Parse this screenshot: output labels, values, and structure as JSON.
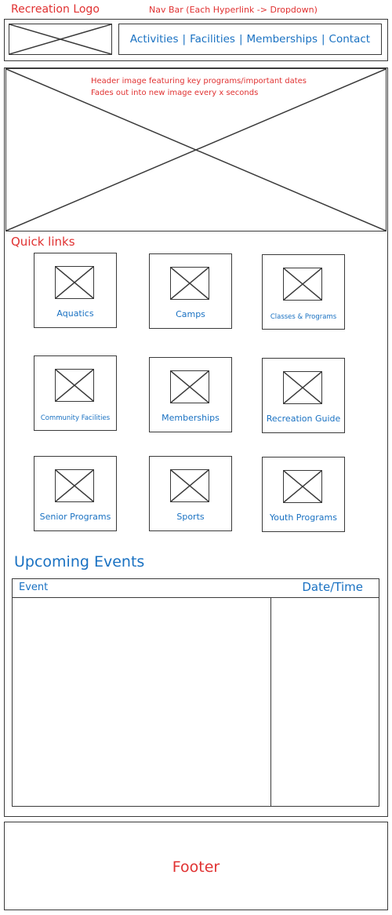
{
  "annotations": {
    "logo_label": "Recreation Logo",
    "nav_label": "Nav Bar (Each Hyperlink -> Dropdown)",
    "header_note_line1": "Header image featuring key programs/important dates",
    "header_note_line2": "Fades out into new image every x seconds"
  },
  "nav": {
    "links": [
      "Activities",
      "Facilities",
      "Memberships",
      "Contact"
    ],
    "separator": "|"
  },
  "quick_links": {
    "title": "Quick links",
    "items": [
      {
        "label": "Aquatics",
        "icon": "image-placeholder-icon"
      },
      {
        "label": "Camps",
        "icon": "image-placeholder-icon"
      },
      {
        "label": "Classes & Programs",
        "icon": "image-placeholder-icon"
      },
      {
        "label": "Community Facilities",
        "icon": "image-placeholder-icon"
      },
      {
        "label": "Memberships",
        "icon": "image-placeholder-icon"
      },
      {
        "label": "Recreation Guide",
        "icon": "image-placeholder-icon"
      },
      {
        "label": "Senior Programs",
        "icon": "image-placeholder-icon"
      },
      {
        "label": "Sports",
        "icon": "image-placeholder-icon"
      },
      {
        "label": "Youth Programs",
        "icon": "image-placeholder-icon"
      }
    ]
  },
  "events": {
    "title": "Upcoming Events",
    "col_event": "Event",
    "col_datetime": "Date/Time"
  },
  "footer": {
    "label": "Footer"
  },
  "colors": {
    "annotation": "#e03131",
    "link": "#1971c2",
    "stroke": "#3a3a3a"
  }
}
